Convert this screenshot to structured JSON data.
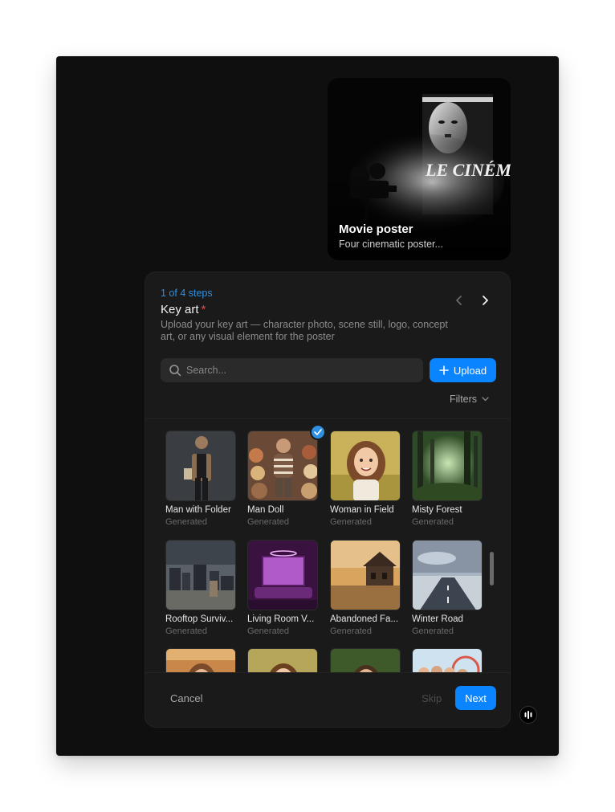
{
  "poster_card": {
    "title": "Movie poster",
    "subtitle": "Four cinematic poster...",
    "art_text": "LE CINÉMA"
  },
  "dialog": {
    "step": "1 of 4 steps",
    "title": "Key art",
    "required_mark": "*",
    "description": "Upload your key art — character photo, scene still, logo, concept art, or any visual element for the poster",
    "search_placeholder": "Search...",
    "upload_label": "Upload",
    "filters_label": "Filters",
    "items": [
      {
        "name": "Man with Folder",
        "source": "Generated",
        "selected": false
      },
      {
        "name": "Man Doll",
        "source": "Generated",
        "selected": true
      },
      {
        "name": "Woman in Field",
        "source": "Generated",
        "selected": false
      },
      {
        "name": "Misty Forest",
        "source": "Generated",
        "selected": false
      },
      {
        "name": "Rooftop Surviv...",
        "source": "Generated",
        "selected": false
      },
      {
        "name": "Living Room V...",
        "source": "Generated",
        "selected": false
      },
      {
        "name": "Abandoned Fa...",
        "source": "Generated",
        "selected": false
      },
      {
        "name": "Winter Road",
        "source": "Generated",
        "selected": false
      }
    ],
    "cancel_label": "Cancel",
    "skip_label": "Skip",
    "next_label": "Next"
  },
  "colors": {
    "accent": "#0a84ff",
    "step_text": "#2f8fe0",
    "required": "#e5484d",
    "background": "#0f0f0f",
    "dialog_bg": "#1a1a1a"
  },
  "icons": [
    "chevron-left-icon",
    "chevron-right-icon",
    "search-icon",
    "plus-icon",
    "chevron-down-icon",
    "check-icon",
    "assistant-icon"
  ]
}
